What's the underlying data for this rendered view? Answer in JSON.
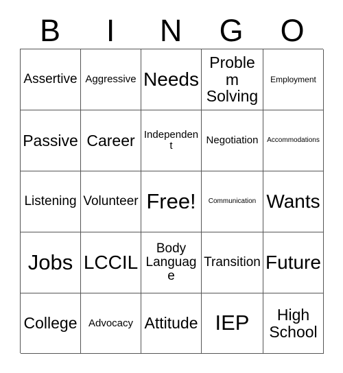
{
  "card": {
    "title": "BINGO",
    "header_letters": [
      "B",
      "I",
      "N",
      "G",
      "O"
    ],
    "free_space_label": "Free!",
    "colors": {
      "background": "#ffffff",
      "text": "#000000",
      "grid_line": "#555555"
    },
    "grid": {
      "columns": 5,
      "rows": 5,
      "cells": [
        {
          "label": "Assertive",
          "size": "md",
          "free": false
        },
        {
          "label": "Aggressive",
          "size": "sm",
          "free": false
        },
        {
          "label": "Needs",
          "size": "xl",
          "free": false
        },
        {
          "label": "Problem Solving",
          "size": "lg",
          "free": false
        },
        {
          "label": "Employment",
          "size": "xs",
          "free": false
        },
        {
          "label": "Passive",
          "size": "lg",
          "free": false
        },
        {
          "label": "Career",
          "size": "lg",
          "free": false
        },
        {
          "label": "Independent",
          "size": "sm",
          "free": false
        },
        {
          "label": "Negotiation",
          "size": "sm",
          "free": false
        },
        {
          "label": "Accommodations",
          "size": "xxs",
          "free": false
        },
        {
          "label": "Listening",
          "size": "md",
          "free": false
        },
        {
          "label": "Volunteer",
          "size": "md",
          "free": false
        },
        {
          "label": "Free!",
          "size": "xxl",
          "free": true
        },
        {
          "label": "Communication",
          "size": "xxs",
          "free": false
        },
        {
          "label": "Wants",
          "size": "xl",
          "free": false
        },
        {
          "label": "Jobs",
          "size": "xxl",
          "free": false
        },
        {
          "label": "LCCIL",
          "size": "xl",
          "free": false
        },
        {
          "label": "Body Language",
          "size": "md",
          "free": false
        },
        {
          "label": "Transition",
          "size": "md",
          "free": false
        },
        {
          "label": "Future",
          "size": "xl",
          "free": false
        },
        {
          "label": "College",
          "size": "lg",
          "free": false
        },
        {
          "label": "Advocacy",
          "size": "sm",
          "free": false
        },
        {
          "label": "Attitude",
          "size": "lg",
          "free": false
        },
        {
          "label": "IEP",
          "size": "xxl",
          "free": false
        },
        {
          "label": "High School",
          "size": "lg",
          "free": false
        }
      ]
    }
  }
}
